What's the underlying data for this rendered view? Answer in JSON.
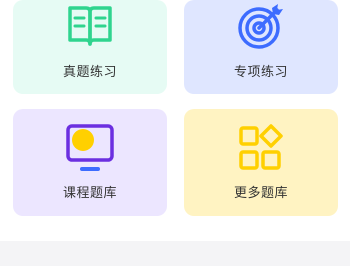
{
  "cards": [
    {
      "label": "真题练习",
      "icon": "open-book-icon",
      "bg": "#e6fbf4",
      "accent": "#2fd48e"
    },
    {
      "label": "专项练习",
      "icon": "target-icon",
      "bg": "#dfe6ff",
      "accent": "#3d6cff"
    },
    {
      "label": "课程题库",
      "icon": "monitor-icon",
      "bg": "#ece6ff",
      "accent": "#6b2fe0"
    },
    {
      "label": "更多题库",
      "icon": "grid-apps-icon",
      "bg": "#fff3c2",
      "accent": "#ffd000"
    }
  ]
}
